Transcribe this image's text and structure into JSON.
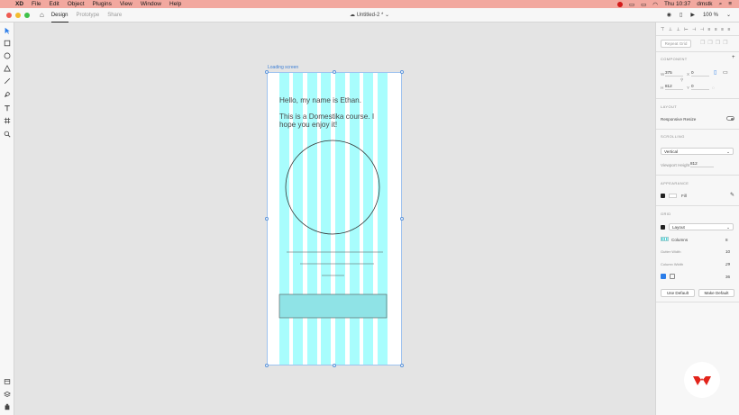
{
  "menubar": {
    "app": "XD",
    "items": [
      "File",
      "Edit",
      "Object",
      "Plugins",
      "View",
      "Window",
      "Help"
    ],
    "clock": "Thu 10:37",
    "user": "dmstk"
  },
  "titlebar": {
    "modes": [
      "Design",
      "Prototype",
      "Share"
    ],
    "document": "Untitled-2 *",
    "zoom": "100 %"
  },
  "artboard": {
    "name": "Loading screen",
    "greeting": "Hello, my name is Ethan.",
    "course_line1": "This is a Domestika course. I",
    "course_line2": "hope you enjoy it!"
  },
  "panel": {
    "repeat_grid": "Repeat Grid",
    "component_title": "COMPONENT",
    "w_label": "W",
    "w_value": "375",
    "h_label": "H",
    "h_value": "812",
    "x_label": "X",
    "x_value": "0",
    "y_label": "Y",
    "y_value": "0",
    "layout_title": "LAYOUT",
    "responsive_resize": "Responsive Resize",
    "scrolling_title": "SCROLLING",
    "scroll_value": "Vertical",
    "viewport_label": "Viewport Height",
    "viewport_value": "812",
    "appearance_title": "APPEARANCE",
    "fill_label": "Fill",
    "grid_title": "GRID",
    "grid_type": "Layout",
    "columns_label": "Columns",
    "columns_value": "8",
    "gutter_label": "Gutter Width",
    "gutter_value": "10",
    "colwidth_label": "Column Width",
    "colwidth_value": "29",
    "margin_value": "36",
    "use_default": "Use Default",
    "make_default": "Make Default"
  },
  "colors": {
    "menubar": "#f2a89f",
    "grid_column": "#a8fdfd",
    "selection": "#5b93d9",
    "brand_red": "#e2231a"
  }
}
